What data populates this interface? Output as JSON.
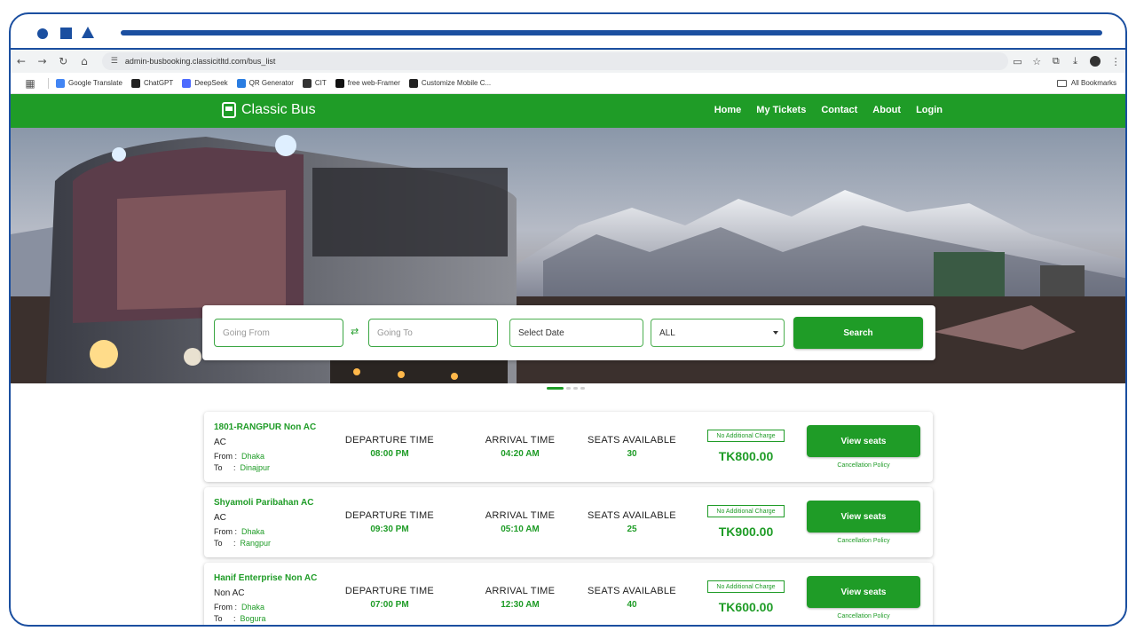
{
  "browser": {
    "url": "admin-busbooking.classicitltd.com/bus_list",
    "bookmarks": [
      {
        "label": "Google Translate",
        "color": "#4285f4"
      },
      {
        "label": "ChatGPT",
        "color": "#222222"
      },
      {
        "label": "DeepSeek",
        "color": "#4d6bfe"
      },
      {
        "label": "QR Generator",
        "color": "#2a7de1"
      },
      {
        "label": "CIT",
        "color": "#333333"
      },
      {
        "label": "free web-Framer",
        "color": "#111111"
      },
      {
        "label": "Customize Mobile C...",
        "color": "#222222"
      }
    ],
    "all_bookmarks": "All Bookmarks"
  },
  "site": {
    "brand": "Classic Bus",
    "nav": [
      "Home",
      "My Tickets",
      "Contact",
      "About",
      "Login"
    ],
    "accent_color": "#1f9c27"
  },
  "search": {
    "from_placeholder": "Going From",
    "to_placeholder": "Going To",
    "date_label": "Select Date",
    "type_selected": "ALL",
    "button": "Search"
  },
  "carousel": {
    "count": 4,
    "active": 0
  },
  "buses": [
    {
      "name": "1801-RANGPUR Non AC",
      "type": "AC",
      "from_label": "From",
      "from": "Dhaka",
      "to_label": "To",
      "to": "Dinajpur",
      "departure_label": "DEPARTURE TIME",
      "departure": "08:00 PM",
      "arrival_label": "ARRIVAL TIME",
      "arrival": "04:20 AM",
      "seats_label": "SEATS AVAILABLE",
      "seats": "30",
      "charge_note": "No Additional Charge",
      "price": "TK800.00",
      "button": "View seats",
      "policy": "Cancellation Policy"
    },
    {
      "name": "Shyamoli Paribahan AC",
      "type": "AC",
      "from_label": "From",
      "from": "Dhaka",
      "to_label": "To",
      "to": "Rangpur",
      "departure_label": "DEPARTURE TIME",
      "departure": "09:30 PM",
      "arrival_label": "ARRIVAL TIME",
      "arrival": "05:10 AM",
      "seats_label": "SEATS AVAILABLE",
      "seats": "25",
      "charge_note": "No Additional Charge",
      "price": "TK900.00",
      "button": "View seats",
      "policy": "Cancellation Policy"
    },
    {
      "name": "Hanif Enterprise Non AC",
      "type": "Non AC",
      "from_label": "From",
      "from": "Dhaka",
      "to_label": "To",
      "to": "Bogura",
      "departure_label": "DEPARTURE TIME",
      "departure": "07:00 PM",
      "arrival_label": "ARRIVAL TIME",
      "arrival": "12:30 AM",
      "seats_label": "SEATS AVAILABLE",
      "seats": "40",
      "charge_note": "No Additional Charge",
      "price": "TK600.00",
      "button": "View seats",
      "policy": "Cancellation Policy"
    }
  ]
}
